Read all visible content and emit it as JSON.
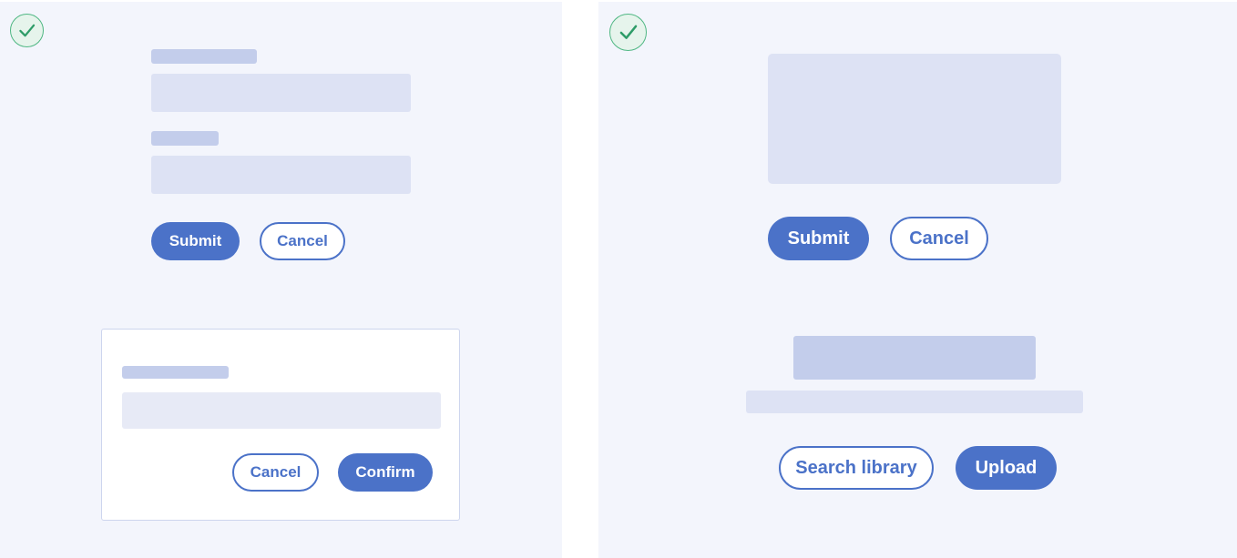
{
  "colors": {
    "panel_background": "#f3f5fc",
    "accent": "#4b72c8",
    "success": "#4fb783",
    "placeholder_label": "#c3cdeb",
    "placeholder_field": "#dde2f4"
  },
  "left_example": {
    "status_icon": "check-circle-icon",
    "form": {
      "submit_label": "Submit",
      "cancel_label": "Cancel"
    },
    "dialog": {
      "cancel_label": "Cancel",
      "confirm_label": "Confirm"
    }
  },
  "right_example": {
    "status_icon": "check-circle-icon",
    "actions": {
      "submit_label": "Submit",
      "cancel_label": "Cancel"
    },
    "empty_state": {
      "search_label": "Search library",
      "upload_label": "Upload"
    }
  }
}
